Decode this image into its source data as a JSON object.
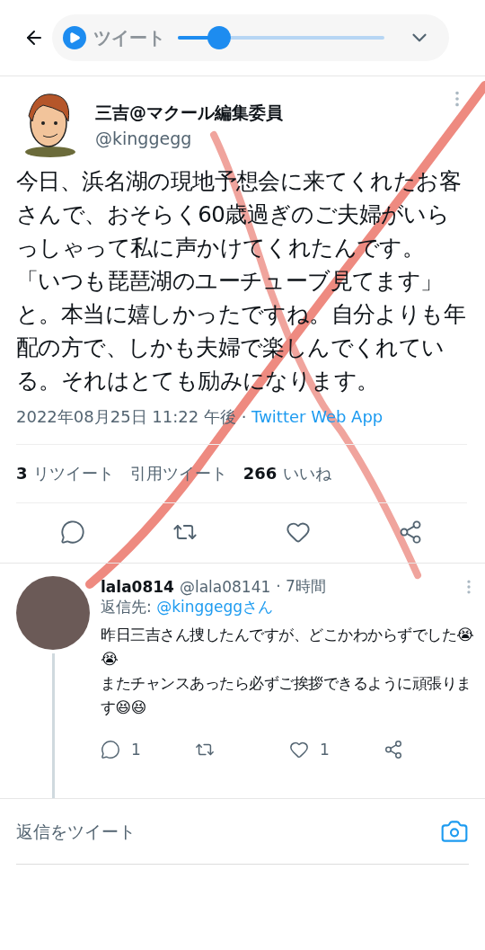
{
  "header": {
    "title": "ツイート",
    "player": {
      "playing": false,
      "level": 0.2
    }
  },
  "tweet": {
    "name": "三吉@マクール編集委員",
    "handle": "@kinggegg",
    "text": [
      "今日、浜名湖の現地予想会に来てくれたお客さんで、おそらく60歳過ぎのご夫婦がいらっしゃって私に声かけてくれたんです。",
      "「いつも琵琶湖のユーチューブ見てます」と。本当に嬉しかったですね。自分よりも年配の方で、しかも夫婦で楽しんでくれている。それはとても励みになります。"
    ],
    "timestamp": "2022年08月25日 11:22 午後 · ",
    "source": "Twitter Web App",
    "stats": [
      {
        "count": "3",
        "label": "リツイート"
      },
      {
        "label": "引用ツイート"
      },
      {
        "count": "266",
        "label": "いいね"
      }
    ]
  },
  "reply": {
    "name": "lala0814",
    "handle": "@lala08141",
    "time": "· 7時間",
    "reply_to_label": "返信先: ",
    "reply_to": "@kinggeggさん",
    "text": [
      "昨日三吉さん捜したんですが、どこかわからずでした😭😭",
      "またチャンスあったら必ずご挨拶できるように頑張ります😆😆"
    ],
    "actions": [
      {
        "kind": "reply",
        "count": "1"
      },
      {
        "kind": "retweet"
      },
      {
        "kind": "like",
        "count": "1"
      },
      {
        "kind": "share"
      }
    ]
  },
  "compose": {
    "placeholder": "返信をツイート"
  }
}
